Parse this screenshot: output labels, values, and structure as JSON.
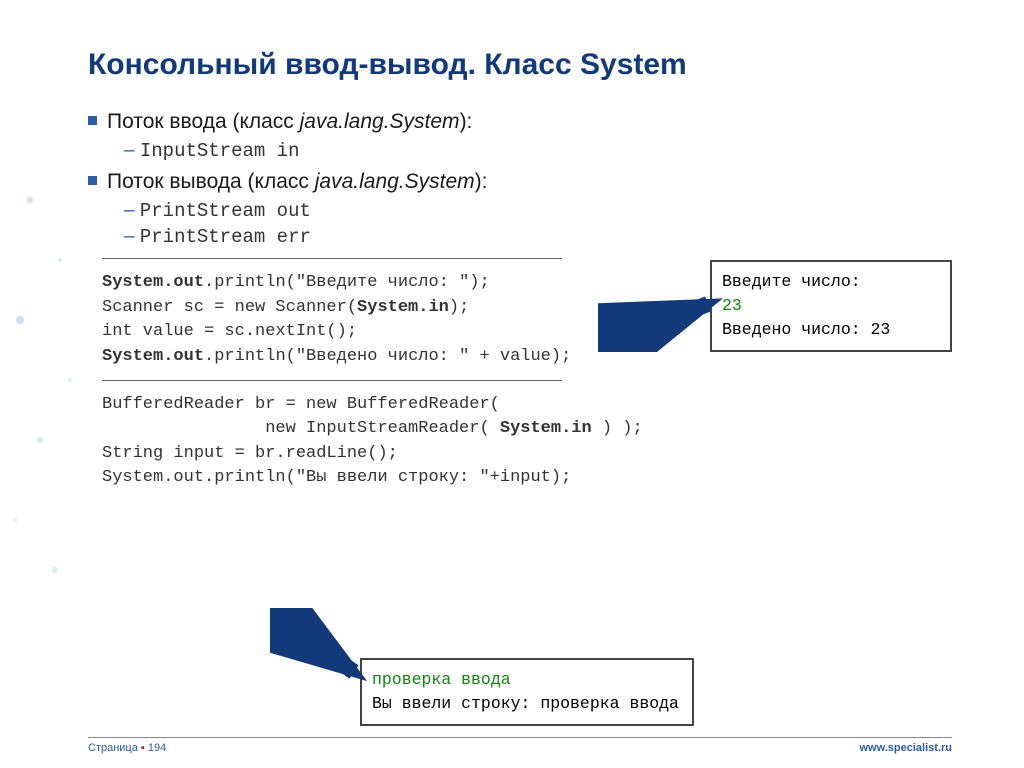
{
  "title": "Консольный ввод-вывод. Класс System",
  "bullets": {
    "in_label": "Поток ввода (класс ",
    "in_class": "java.lang.System",
    "in_tail": "):",
    "in_sub": "InputStream in",
    "out_label": "Поток вывода (класс ",
    "out_class": "java.lang.System",
    "out_tail": "):",
    "out_sub1": "PrintStream out",
    "out_sub2": "PrintStream err"
  },
  "code1": {
    "l1a": "System.out",
    "l1b": ".println(\"Введите число: \");",
    "l2a": "Scanner sc = new Scanner(",
    "l2b": "System.in",
    "l2c": ");",
    "l3": "int value = sc.nextInt();",
    "l4a": "System.out",
    "l4b": ".println(\"Введено число: \" + value);"
  },
  "code2": {
    "l1": "BufferedReader br = new BufferedReader(",
    "l2a": "                new InputStreamReader( ",
    "l2b": "System.in",
    "l2c": " ) );",
    "l3": "String input = br.readLine();",
    "l4": "System.out.println(\"Вы ввели строку: \"+input);"
  },
  "output1": {
    "l1": "Введите число:",
    "l2": "23",
    "l3": "Введено число: 23"
  },
  "output2": {
    "l1": "проверка ввода",
    "l2": "Вы ввели строку: проверка ввода"
  },
  "footer": {
    "page_label": "Страница ",
    "page_num": "194",
    "url": "www.specialist.ru"
  }
}
